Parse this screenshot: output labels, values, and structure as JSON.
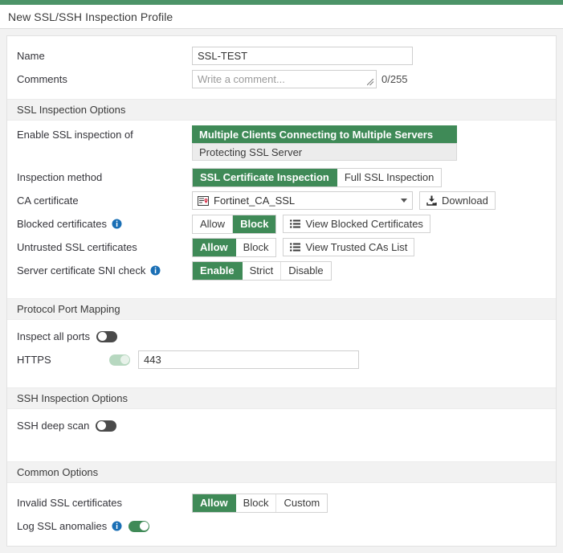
{
  "window": {
    "title": "New SSL/SSH Inspection Profile",
    "accent_color": "#4c9468",
    "selected_color": "#3f8a57",
    "info_icon_color": "#1a6fb5"
  },
  "general": {
    "name_label": "Name",
    "name_value": "SSL-TEST",
    "comments_label": "Comments",
    "comments_value": "",
    "comments_placeholder": "Write a comment...",
    "comments_counter": "0/255"
  },
  "ssl_section": {
    "heading": "SSL Inspection Options",
    "enable_inspection": {
      "label": "Enable SSL inspection of",
      "options": [
        "Multiple Clients Connecting to Multiple Servers",
        "Protecting SSL Server"
      ],
      "selected": 0
    },
    "inspection_method": {
      "label": "Inspection method",
      "options": [
        "SSL Certificate Inspection",
        "Full SSL Inspection"
      ],
      "selected": 0
    },
    "ca_certificate": {
      "label": "CA certificate",
      "value": "Fortinet_CA_SSL",
      "icon": "certificate-icon",
      "download_label": "Download",
      "download_icon": "download-icon"
    },
    "blocked_certificates": {
      "label": "Blocked certificates",
      "has_info": true,
      "info_icon": "info-icon",
      "options": [
        "Allow",
        "Block"
      ],
      "selected": 1,
      "action_label": "View Blocked Certificates",
      "action_icon": "list-icon"
    },
    "untrusted_certificates": {
      "label": "Untrusted SSL certificates",
      "has_info": false,
      "options": [
        "Allow",
        "Block"
      ],
      "selected": 0,
      "action_label": "View Trusted CAs List",
      "action_icon": "list-icon"
    },
    "sni_check": {
      "label": "Server certificate SNI check",
      "has_info": true,
      "info_icon": "info-icon",
      "options": [
        "Enable",
        "Strict",
        "Disable"
      ],
      "selected": 0
    }
  },
  "port_section": {
    "heading": "Protocol Port Mapping",
    "inspect_all_ports": {
      "label": "Inspect all ports",
      "state": "off"
    },
    "https": {
      "label": "HTTPS",
      "state": "on",
      "port_value": "443"
    }
  },
  "ssh_section": {
    "heading": "SSH Inspection Options",
    "ssh_deep_scan": {
      "label": "SSH deep scan",
      "state": "off"
    }
  },
  "common_section": {
    "heading": "Common Options",
    "invalid_ssl_certificates": {
      "label": "Invalid SSL certificates",
      "options": [
        "Allow",
        "Block",
        "Custom"
      ],
      "selected": 0
    },
    "log_ssl_anomalies": {
      "label": "Log SSL anomalies",
      "has_info": true,
      "info_icon": "info-icon",
      "state": "on"
    }
  }
}
